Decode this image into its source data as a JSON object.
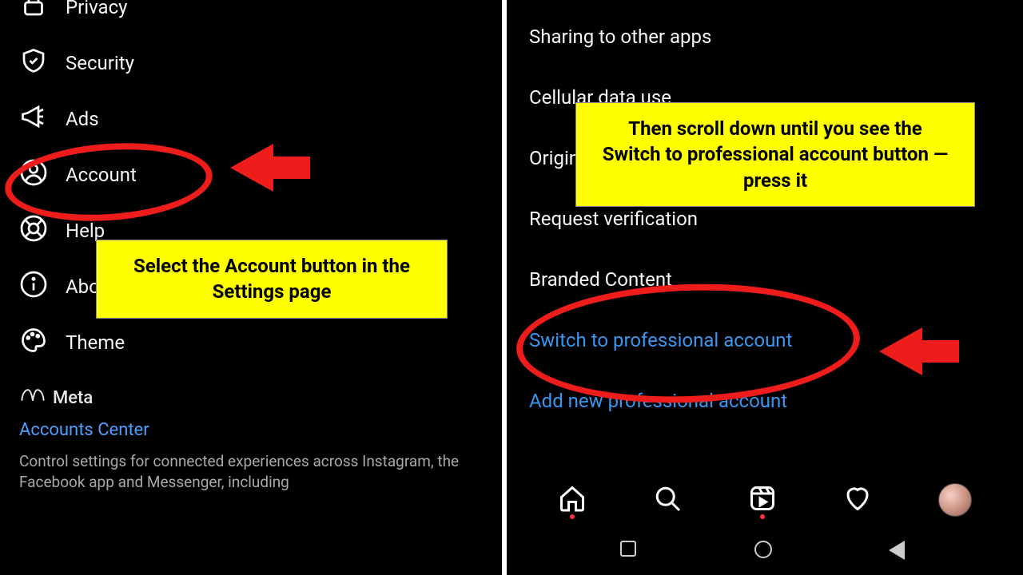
{
  "left": {
    "menu": {
      "privacy": "Privacy",
      "security": "Security",
      "ads": "Ads",
      "account": "Account",
      "help": "Help",
      "about": "About",
      "theme": "Theme"
    },
    "meta": {
      "brand": "Meta",
      "accounts_center": "Accounts Center",
      "description": "Control settings for connected experiences across Instagram, the Facebook app and Messenger, including"
    }
  },
  "right": {
    "items": {
      "sharing": "Sharing to other apps",
      "cellular": "Cellular data use",
      "original": "Original posts",
      "verification": "Request verification",
      "branded": "Branded Content",
      "switch_pro": "Switch to professional account",
      "add_pro": "Add new professional account"
    }
  },
  "callouts": {
    "c1": "Select the Account button in the Settings page",
    "c2": "Then scroll down until you see the Switch to professional account button — press it"
  }
}
